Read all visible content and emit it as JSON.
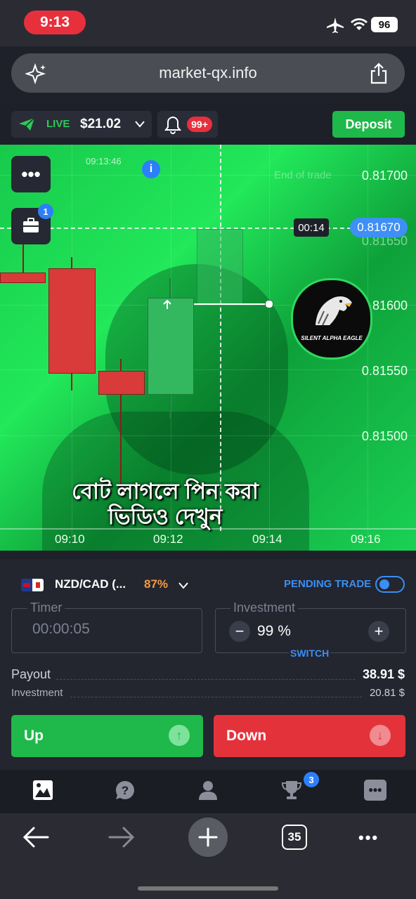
{
  "status_bar": {
    "time": "9:13",
    "battery": "96"
  },
  "browser": {
    "url": "market-qx.info",
    "tabs_count": "35"
  },
  "header": {
    "account_mode": "LIVE",
    "balance": "$21.02",
    "notifications_badge": "99+",
    "deposit_label": "Deposit"
  },
  "chart": {
    "overlay_time": "09:13:46",
    "faded_label": "End of trade",
    "price_labels": [
      "0.81700",
      "0.81650",
      "81600",
      "0.81550",
      "0.81500"
    ],
    "current_price": "0.81670",
    "countdown": "00:14",
    "time_ticks": [
      "09:10",
      "09:12",
      "09:14",
      "09:16"
    ],
    "portfolio_badge": "1",
    "watermark_logo": "SILENT ALPHA EAGLE",
    "subtitle_line1": "বোট লাগলে পিন করা",
    "subtitle_line2": "ভিডিও দেখুন"
  },
  "trade_panel": {
    "pair": "NZD/CAD (...",
    "payout_percent": "87%",
    "pending_trade_label": "PENDING TRADE",
    "timer_label": "Timer",
    "timer_value": "00:00:05",
    "investment_label": "Investment",
    "investment_value": "99 %",
    "switch_label": "SWITCH",
    "payout_row_label": "Payout",
    "payout_row_value": "38.91 $",
    "investment_row_label": "Investment",
    "investment_row_value": "20.81 $",
    "up_label": "Up",
    "down_label": "Down"
  },
  "app_nav": {
    "trophy_badge": "3"
  },
  "colors": {
    "live_green": "#1fb84a",
    "down_red": "#e4323b",
    "accent_blue": "#3a8ff5",
    "payout_orange": "#f49b42",
    "badge_red": "#e8303d"
  }
}
